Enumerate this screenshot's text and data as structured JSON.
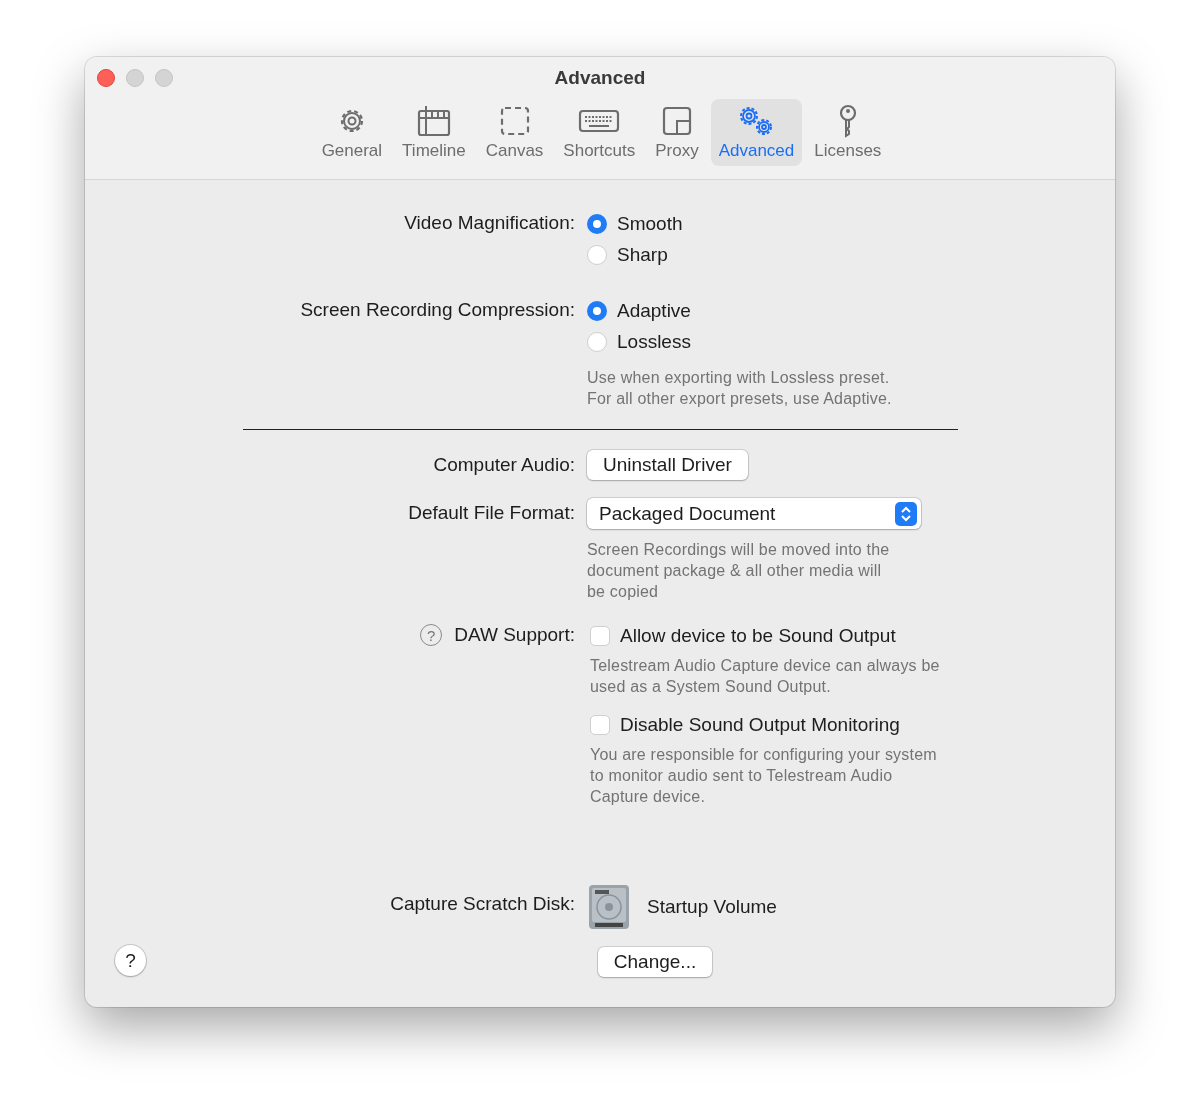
{
  "window": {
    "title": "Advanced"
  },
  "tabs": [
    {
      "label": "General",
      "kind": "gear",
      "selected": false
    },
    {
      "label": "Timeline",
      "kind": "clapper",
      "selected": false
    },
    {
      "label": "Canvas",
      "kind": "canvas",
      "selected": false
    },
    {
      "label": "Shortcuts",
      "kind": "keyboard",
      "selected": false
    },
    {
      "label": "Proxy",
      "kind": "proxy",
      "selected": false
    },
    {
      "label": "Advanced",
      "kind": "gears",
      "selected": true
    },
    {
      "label": "Licenses",
      "kind": "key",
      "selected": false
    }
  ],
  "video_magnification": {
    "label": "Video Magnification:",
    "options": [
      {
        "label": "Smooth",
        "selected": true
      },
      {
        "label": "Sharp",
        "selected": false
      }
    ]
  },
  "screen_recording_compression": {
    "label": "Screen Recording Compression:",
    "options": [
      {
        "label": "Adaptive",
        "selected": true
      },
      {
        "label": "Lossless",
        "selected": false
      }
    ],
    "hint": [
      "Use when exporting with Lossless preset.",
      "For all other export presets, use Adaptive."
    ]
  },
  "computer_audio": {
    "label": "Computer Audio:",
    "button": "Uninstall Driver"
  },
  "default_file_format": {
    "label": "Default File Format:",
    "value": "Packaged Document",
    "hint": [
      "Screen Recordings will be moved into the",
      "document package & all other media will",
      "be copied"
    ]
  },
  "daw_support": {
    "help": "?",
    "label": "DAW Support:",
    "options": [
      {
        "label": "Allow device to be Sound Output",
        "checked": false,
        "hint": [
          "Telestream Audio Capture device can always be",
          "used as a System Sound Output."
        ]
      },
      {
        "label": "Disable Sound Output Monitoring",
        "checked": false,
        "hint": [
          "You are responsible for configuring your system",
          "to monitor audio sent to Telestream Audio",
          "Capture device."
        ]
      }
    ]
  },
  "capture_scratch_disk": {
    "label": "Capture Scratch Disk:",
    "volume": "Startup Volume",
    "button": "Change..."
  },
  "help_button": "?"
}
